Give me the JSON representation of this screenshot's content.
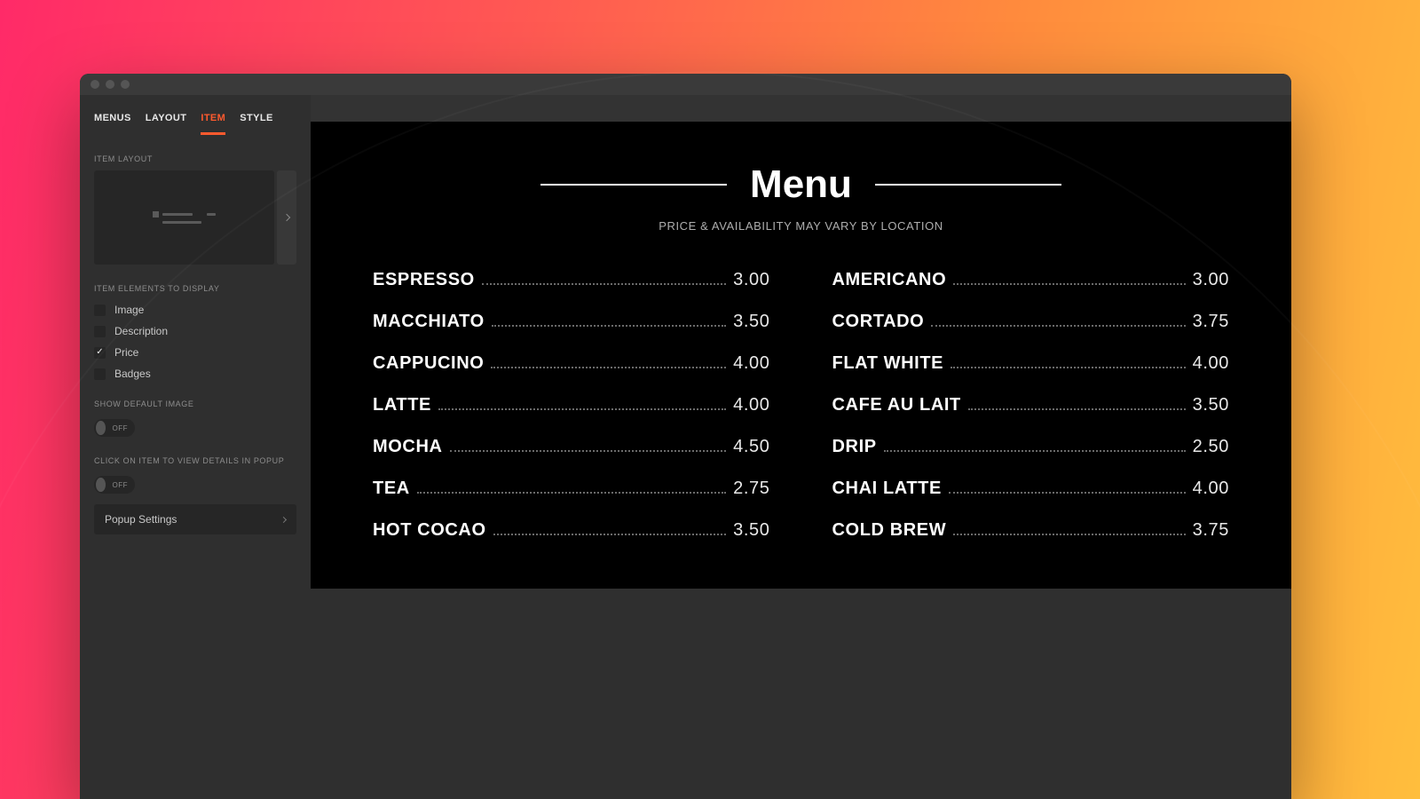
{
  "sidebar": {
    "tabs": [
      "MENUS",
      "LAYOUT",
      "ITEM",
      "STYLE"
    ],
    "active_tab_index": 2,
    "section_item_layout": "ITEM LAYOUT",
    "section_elements": "ITEM ELEMENTS TO DISPLAY",
    "checks": [
      {
        "label": "Image",
        "checked": false
      },
      {
        "label": "Description",
        "checked": false
      },
      {
        "label": "Price",
        "checked": true
      },
      {
        "label": "Badges",
        "checked": false
      }
    ],
    "section_default_image": "SHOW DEFAULT IMAGE",
    "toggle_default_image": {
      "state": "OFF"
    },
    "section_popup": "CLICK ON ITEM TO VIEW DETAILS IN POPUP",
    "toggle_popup": {
      "state": "OFF"
    },
    "popup_settings_label": "Popup Settings"
  },
  "menu": {
    "title": "Menu",
    "subtitle": "PRICE & AVAILABILITY MAY VARY BY LOCATION",
    "left": [
      {
        "name": "ESPRESSO",
        "price": "3.00"
      },
      {
        "name": "MACCHIATO",
        "price": "3.50"
      },
      {
        "name": "CAPPUCINO",
        "price": "4.00"
      },
      {
        "name": "LATTE",
        "price": "4.00"
      },
      {
        "name": "MOCHA",
        "price": "4.50"
      },
      {
        "name": "TEA",
        "price": "2.75"
      },
      {
        "name": "HOT COCAO",
        "price": "3.50"
      }
    ],
    "right": [
      {
        "name": "AMERICANO",
        "price": "3.00"
      },
      {
        "name": "CORTADO",
        "price": "3.75"
      },
      {
        "name": "FLAT WHITE",
        "price": "4.00"
      },
      {
        "name": "CAFE AU LAIT",
        "price": "3.50"
      },
      {
        "name": "DRIP",
        "price": "2.50"
      },
      {
        "name": "CHAI LATTE",
        "price": "4.00"
      },
      {
        "name": "COLD BREW",
        "price": "3.75"
      }
    ]
  }
}
